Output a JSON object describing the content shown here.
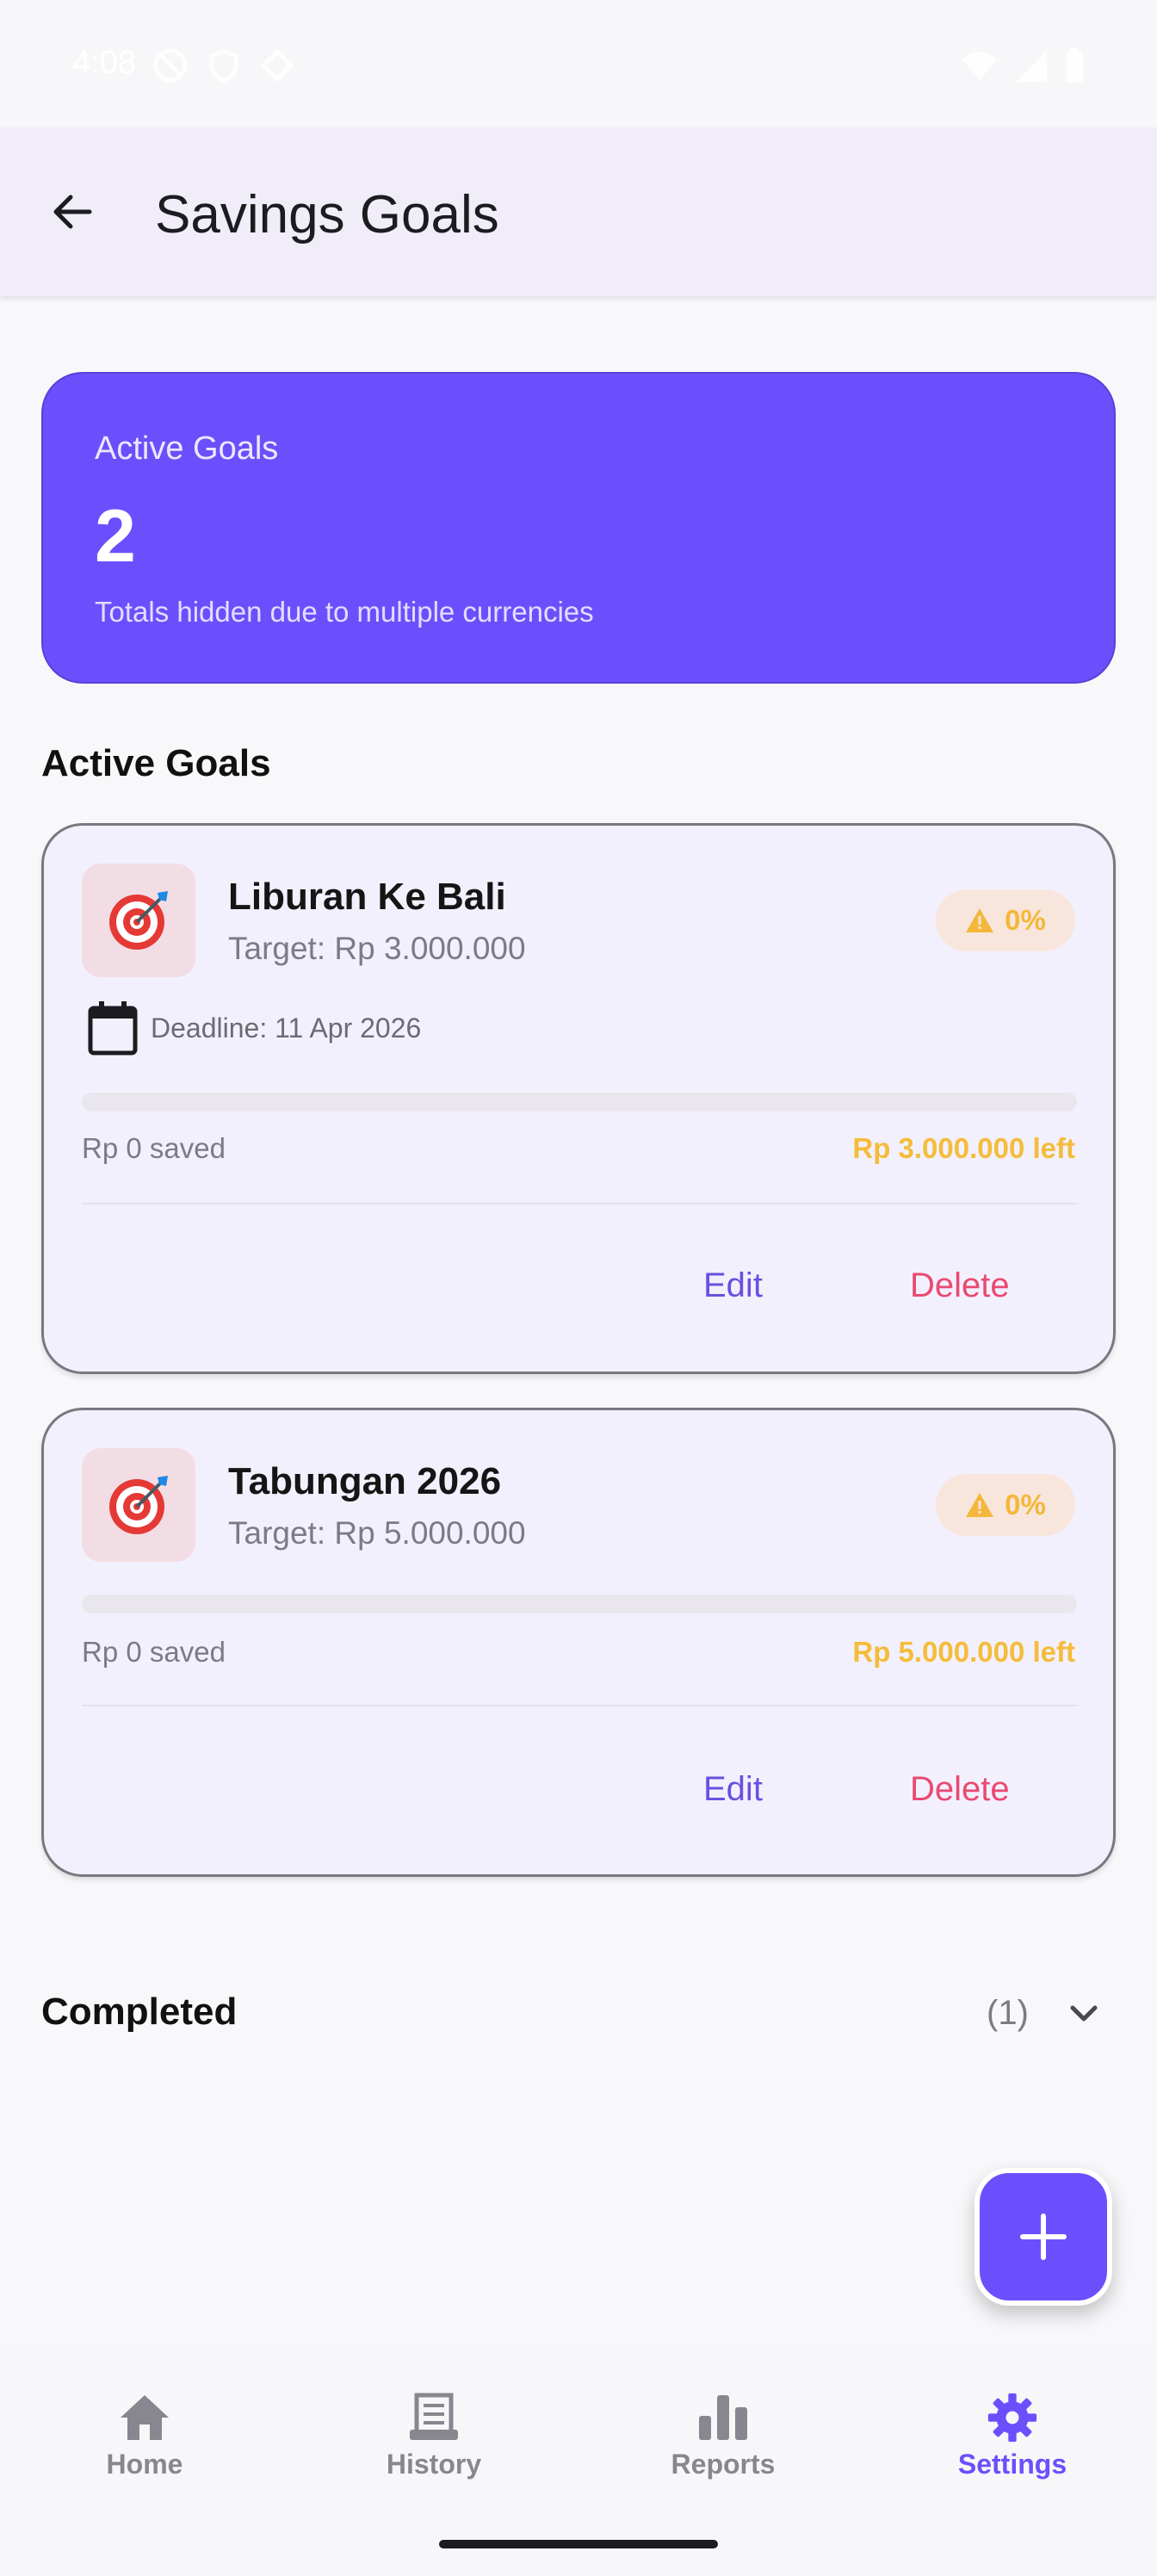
{
  "status_bar": {
    "time": "4:08"
  },
  "app_bar": {
    "title": "Savings Goals",
    "back_icon": "arrow-back-icon"
  },
  "summary": {
    "label": "Active Goals",
    "count": "2",
    "note": "Totals hidden due to multiple currencies",
    "color": "#6c4ffc"
  },
  "section_active": {
    "title": "Active Goals"
  },
  "goals": [
    {
      "icon": "target-emoji-icon",
      "name": "Liburan Ke Bali",
      "target": "Target: Rp 3.000.000",
      "percent_label": "0%",
      "progress": 0,
      "deadline": "Deadline: 11 Apr 2026",
      "saved": "Rp 0 saved",
      "left": "Rp 3.000.000 left",
      "edit_label": "Edit",
      "delete_label": "Delete"
    },
    {
      "icon": "target-emoji-icon",
      "name": "Tabungan 2026",
      "target": "Target: Rp 5.000.000",
      "percent_label": "0%",
      "progress": 0,
      "saved": "Rp 0 saved",
      "left": "Rp 5.000.000 left",
      "edit_label": "Edit",
      "delete_label": "Delete"
    }
  ],
  "completed": {
    "title": "Completed",
    "count": "(1)"
  },
  "fab": {
    "icon": "plus-icon"
  },
  "bottom_nav": {
    "items": [
      {
        "label": "Home",
        "icon": "home-icon",
        "active": false
      },
      {
        "label": "History",
        "icon": "receipt-icon",
        "active": false
      },
      {
        "label": "Reports",
        "icon": "bar-chart-icon",
        "active": false
      },
      {
        "label": "Settings",
        "icon": "gear-icon",
        "active": true
      }
    ]
  },
  "colors": {
    "accent": "#6c4ffc",
    "warning": "#f5bc3a",
    "danger": "#e94a72"
  }
}
